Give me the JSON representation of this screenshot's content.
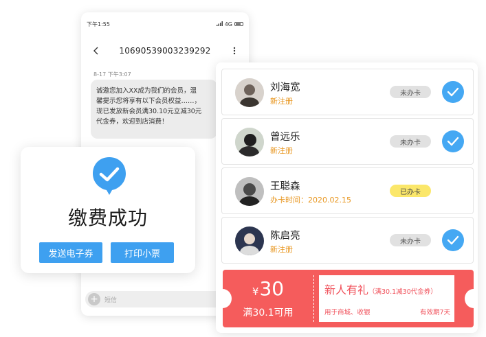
{
  "phone": {
    "status_time": "下午1:55",
    "status_network": "4G",
    "sender_number": "10690539003239292",
    "message_time": "8-17 下午3:07",
    "message_lines": [
      "诚邀您加入XX成为我们的会员，温",
      "馨提示您将享有以下会员权益……，",
      "现已发放新会员满30.10元立减30元",
      "代金券，欢迎到店消费！"
    ],
    "input_placeholder": "短信"
  },
  "payment": {
    "title": "缴费成功",
    "send_coupon_label": "发送电子券",
    "print_receipt_label": "打印小票"
  },
  "members": [
    {
      "name": "刘海宽",
      "sub": "新注册",
      "badge": "未办卡",
      "has_card": false,
      "checked": true
    },
    {
      "name": "曾远乐",
      "sub": "新注册",
      "badge": "未办卡",
      "has_card": false,
      "checked": true
    },
    {
      "name": "王聪森",
      "sub": "办卡时间：2020.02.15",
      "badge": "已办卡",
      "has_card": true,
      "checked": false
    },
    {
      "name": "陈启亮",
      "sub": "新注册",
      "badge": "未办卡",
      "has_card": false,
      "checked": true
    }
  ],
  "coupon": {
    "currency": "¥",
    "amount": "30",
    "condition": "满30.1可用",
    "title": "新人有礼",
    "title_note": "（满30.1减30代金券）",
    "usage": "用于商城、收银",
    "validity": "有效期7天"
  },
  "colors": {
    "primary_blue": "#3ea0f0",
    "coupon_red": "#f55c5c",
    "accent_orange": "#e8961f",
    "badge_yellow": "#fbe76a"
  }
}
